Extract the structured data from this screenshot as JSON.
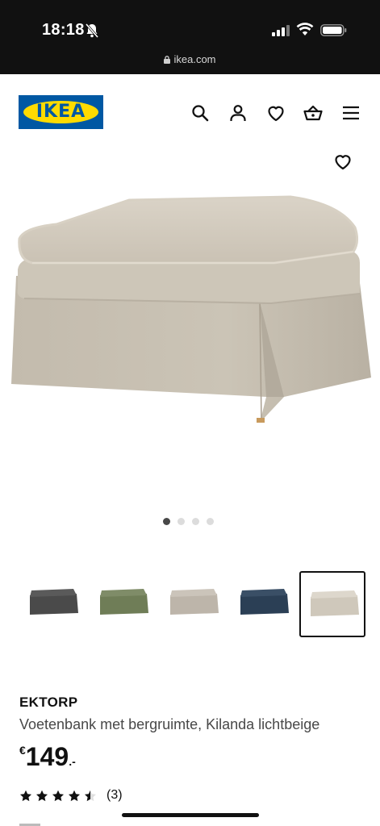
{
  "status_bar": {
    "time": "18:18",
    "url": "ikea.com"
  },
  "header": {
    "logo_text": "IKEA",
    "icons": [
      "search-icon",
      "profile-icon",
      "heart-icon",
      "basket-icon",
      "menu-icon"
    ]
  },
  "gallery": {
    "dot_count": 4,
    "active_dot": 0,
    "thumbnails": [
      {
        "color": "#4a4a4a"
      },
      {
        "color": "#6f7d57"
      },
      {
        "color": "#bdb5aa"
      },
      {
        "color": "#2b3f55"
      },
      {
        "color": "#cfc8bb"
      }
    ],
    "selected_thumbnail": 4
  },
  "product": {
    "name": "EKTORP",
    "description": "Voetenbank met bergruimte, Kilanda lichtbeige",
    "price_currency": "€",
    "price_amount": "149",
    "price_decimals": ".-",
    "rating_value": 4.5,
    "rating_max": 5,
    "review_count": "(3)"
  },
  "colors": {
    "ikea_blue": "#0058a3",
    "ikea_yellow": "#ffdb00",
    "fabric": "#cfc8bb"
  }
}
